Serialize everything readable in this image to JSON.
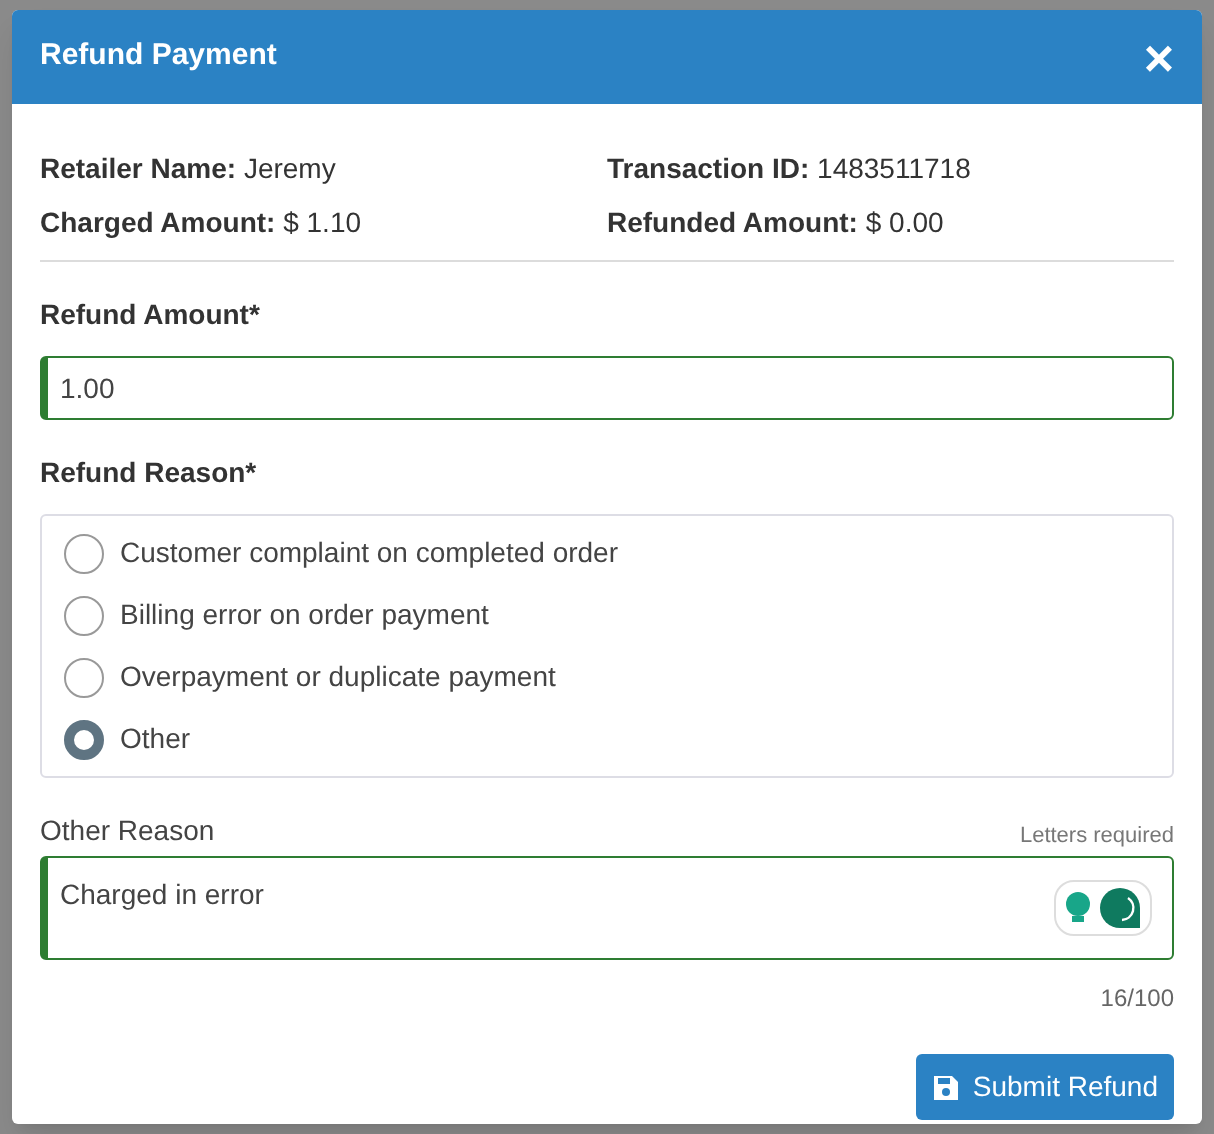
{
  "dialog": {
    "title": "Refund Payment",
    "close": "×"
  },
  "details": [
    {
      "label": "Retailer Name:",
      "value": "Jeremy"
    },
    {
      "label": "Transaction ID:",
      "value": "1483511718"
    },
    {
      "label": "Charged Amount:",
      "value": "$ 1.10"
    },
    {
      "label": "Refunded Amount:",
      "value": "$ 0.00"
    }
  ],
  "refund_amount": {
    "label": "Refund Amount*",
    "value": "1.00"
  },
  "refund_reason": {
    "label": "Refund Reason*",
    "options": [
      {
        "label": "Customer complaint on completed order",
        "selected": false
      },
      {
        "label": "Billing error on order payment",
        "selected": false
      },
      {
        "label": "Overpayment or duplicate payment",
        "selected": false
      },
      {
        "label": "Other",
        "selected": true
      }
    ]
  },
  "other_reason": {
    "label": "Other Reason",
    "hint": "Letters required",
    "value": "Charged in error",
    "counter": "16/100"
  },
  "submit": {
    "label": "Submit Refund"
  }
}
